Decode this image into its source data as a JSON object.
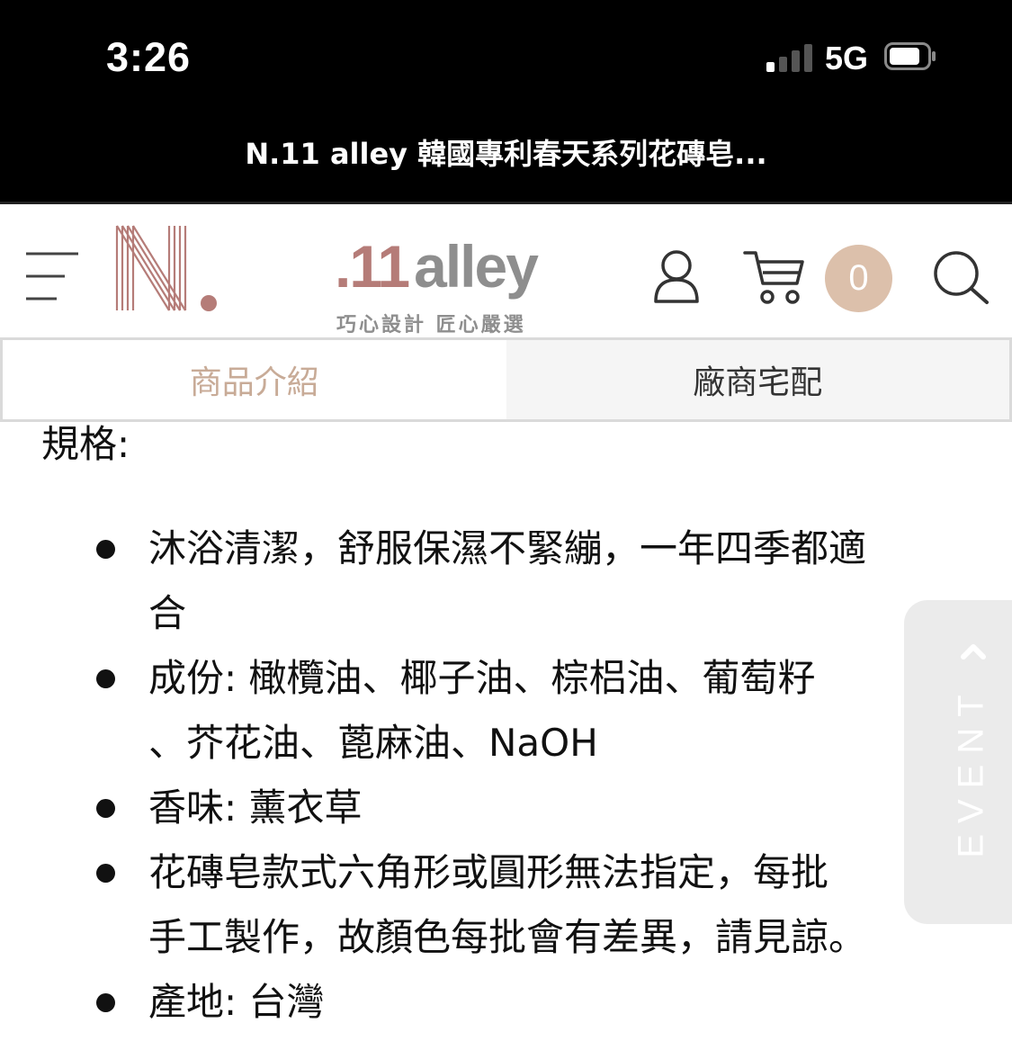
{
  "status_bar": {
    "time": "3:26",
    "network": "5G",
    "icons": [
      "signal-icon",
      "battery-icon"
    ]
  },
  "browser": {
    "page_title": "N.11 alley 韓國專利春天系列花磚皂..."
  },
  "header": {
    "logo": {
      "number": ".11",
      "word": "alley",
      "tagline": "巧心設計 匠心嚴選"
    },
    "cart_count": "0",
    "icons": [
      "menu-icon",
      "user-icon",
      "cart-icon",
      "search-icon"
    ],
    "colors": {
      "logo_accent": "#b57c78",
      "logo_gray": "#8e8e8e",
      "badge": "#dcc0ab"
    }
  },
  "tabs": [
    {
      "label": "商品介紹",
      "active": true
    },
    {
      "label": "廠商宅配",
      "active": false
    }
  ],
  "colors": {
    "tab_active_text": "#c8ab97"
  },
  "content": {
    "heading": "規格:",
    "items": [
      {
        "lines": [
          "沐浴清潔，舒服保濕不緊繃，一年四季都適",
          "合"
        ]
      },
      {
        "lines": [
          "成份: 橄欖油、椰子油、棕梠油、葡萄籽",
          "、芥花油、蓖麻油、NaOH"
        ]
      },
      {
        "lines": [
          "香味: 薰衣草"
        ]
      },
      {
        "lines": [
          "花磚皂款式六角形或圓形無法指定，每批",
          "手工製作，故顏色每批會有差異，請見諒。"
        ]
      },
      {
        "lines": [
          "產地: 台灣"
        ]
      }
    ]
  },
  "event_tab": {
    "label": "EVENT"
  }
}
